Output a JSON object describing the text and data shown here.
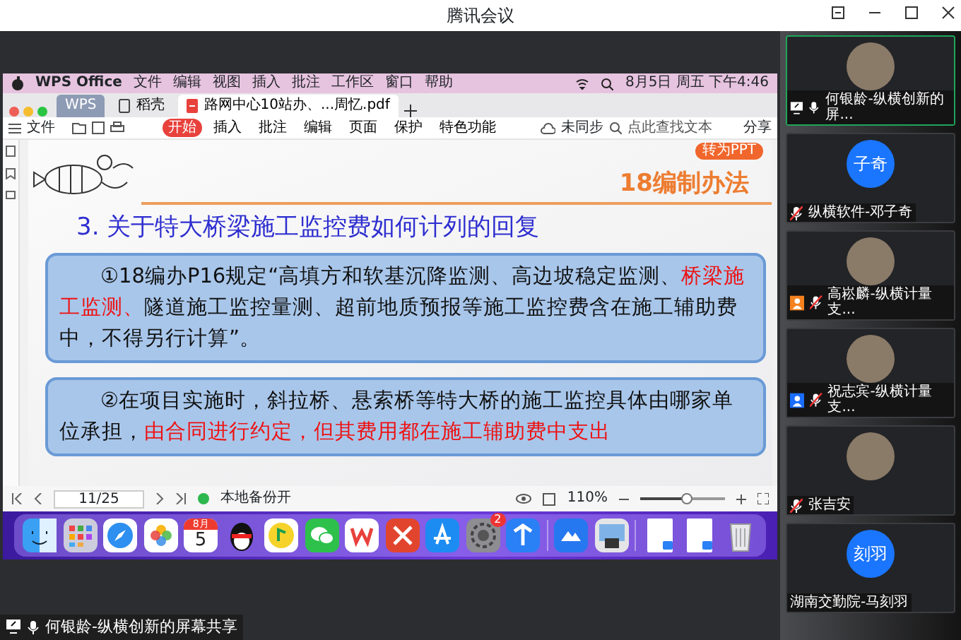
{
  "window": {
    "title": "腾讯会议"
  },
  "shared_screen": {
    "menu_bar": {
      "app": "WPS Office",
      "items": [
        "文件",
        "编辑",
        "视图",
        "插入",
        "批注",
        "工作区",
        "窗口",
        "帮助"
      ],
      "clock": "8月5日 周五 下午4:46"
    },
    "tabs": [
      {
        "label": "WPS",
        "kind": "home",
        "selected": false
      },
      {
        "label": "稻壳",
        "kind": "doc",
        "selected": false
      },
      {
        "label": "路网中心10站办、...周忆.pdf",
        "kind": "pdf",
        "selected": true
      }
    ],
    "toolbar": {
      "file": "文件",
      "tabs": [
        {
          "label": "开始",
          "selected": true
        },
        {
          "label": "插入",
          "selected": false
        },
        {
          "label": "批注",
          "selected": false
        },
        {
          "label": "编辑",
          "selected": false
        },
        {
          "label": "页面",
          "selected": false
        },
        {
          "label": "保护",
          "selected": false
        },
        {
          "label": "特色功能",
          "selected": false
        }
      ],
      "sync": "未同步",
      "search": {
        "placeholder": "点此查找文本"
      },
      "share": "分享"
    },
    "slide": {
      "badge": "转为PPT",
      "heading": "18编制办法",
      "title": "3. 关于特大桥梁施工监控费如何计列的回复",
      "paragraphs": [
        [
          {
            "text": "①18编办P16规定“高填方和软基沉降监测、高边坡稳定监测、",
            "red": false
          },
          {
            "text": "桥梁施工监测、",
            "red": true
          },
          {
            "text": "隧道施工监控量测、超前地质预报等施工监控费含在施工辅助费中，不得另行计算”。",
            "red": false
          }
        ],
        [
          {
            "text": "②在项目实施时，斜拉桥、悬索桥等特大桥的施工监控具体由哪家单位承担，",
            "red": false
          },
          {
            "text": "由合同进行约定，但其费用都在施工辅助费中支出",
            "red": true
          }
        ]
      ]
    },
    "status_bar": {
      "page": "11/25",
      "backup": "本地备份开",
      "zoom": "110%",
      "zoom_slider": {
        "level": 0.55
      }
    },
    "dock": [
      {
        "kind": "finder"
      },
      {
        "kind": "launchpad"
      },
      {
        "kind": "safari"
      },
      {
        "kind": "photos"
      },
      {
        "kind": "calendar",
        "month": "8月",
        "day": "5"
      },
      {
        "kind": "qq"
      },
      {
        "kind": "music"
      },
      {
        "kind": "wechat"
      },
      {
        "kind": "wps"
      },
      {
        "kind": "xmind"
      },
      {
        "kind": "appstore"
      },
      {
        "kind": "settings",
        "badge": "2"
      },
      {
        "kind": "arrow"
      },
      {
        "kind": "meeting"
      },
      {
        "kind": "preview"
      },
      {
        "kind": "window"
      },
      {
        "kind": "window"
      },
      {
        "kind": "trash"
      }
    ]
  },
  "participants": [
    {
      "name": "何银龄-纵横创新的屏...",
      "mic_muted": false,
      "sharing": true,
      "selected": true
    },
    {
      "name": "纵横软件-邓子奇",
      "initials": "子奇",
      "mic_muted": true,
      "sharing": false,
      "selected": false
    },
    {
      "name": "高崧麟-纵横计量支...",
      "mic_muted": true,
      "sharing": false,
      "color": "#f5821f",
      "selected": false
    },
    {
      "name": "祝志宾-纵横计量支...",
      "mic_muted": true,
      "sharing": false,
      "color": "#1a6dff",
      "selected": false
    },
    {
      "name": "张吉安",
      "mic_muted": true,
      "sharing": false,
      "selected": false
    },
    {
      "name": "湖南交勤院-马刻羽",
      "initials": "刻羽",
      "sharing": false,
      "selected": false
    }
  ],
  "stage_label": {
    "text": "何银龄-纵横创新的屏幕共享",
    "mic_muted": false,
    "sharing": true
  }
}
